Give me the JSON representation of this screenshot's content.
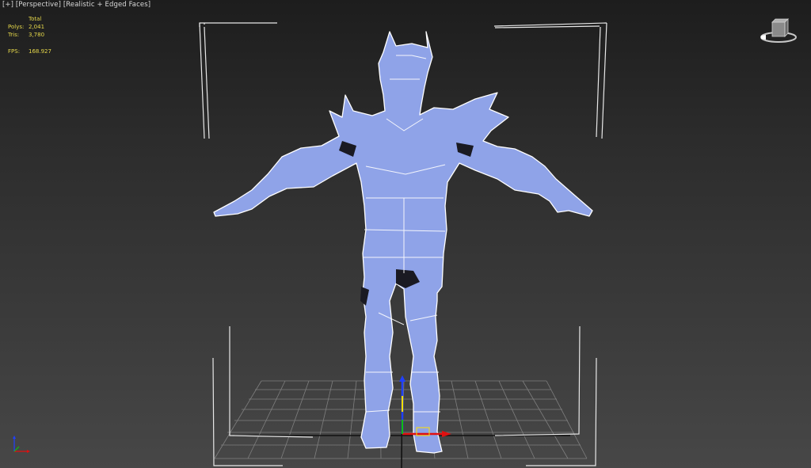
{
  "viewport": {
    "menu": {
      "plus": "[+]",
      "view": "[Perspective]",
      "shading": "[Realistic + Edged Faces]"
    },
    "stats": {
      "header": "Total",
      "polys_label": "Polys:",
      "polys_value": "2,041",
      "tris_label": "Tris:",
      "tris_value": "3,780",
      "fps_label": "FPS:",
      "fps_value": "168.927"
    },
    "colors": {
      "mesh_fill": "#8fa3e8",
      "wire": "#f4f4f4",
      "stats_text": "#e6d84a",
      "axis_x": "#e01010",
      "axis_y": "#10c010",
      "axis_z": "#2040ff"
    },
    "icons": [
      "view-cube-icon",
      "axis-tripod-icon"
    ]
  }
}
